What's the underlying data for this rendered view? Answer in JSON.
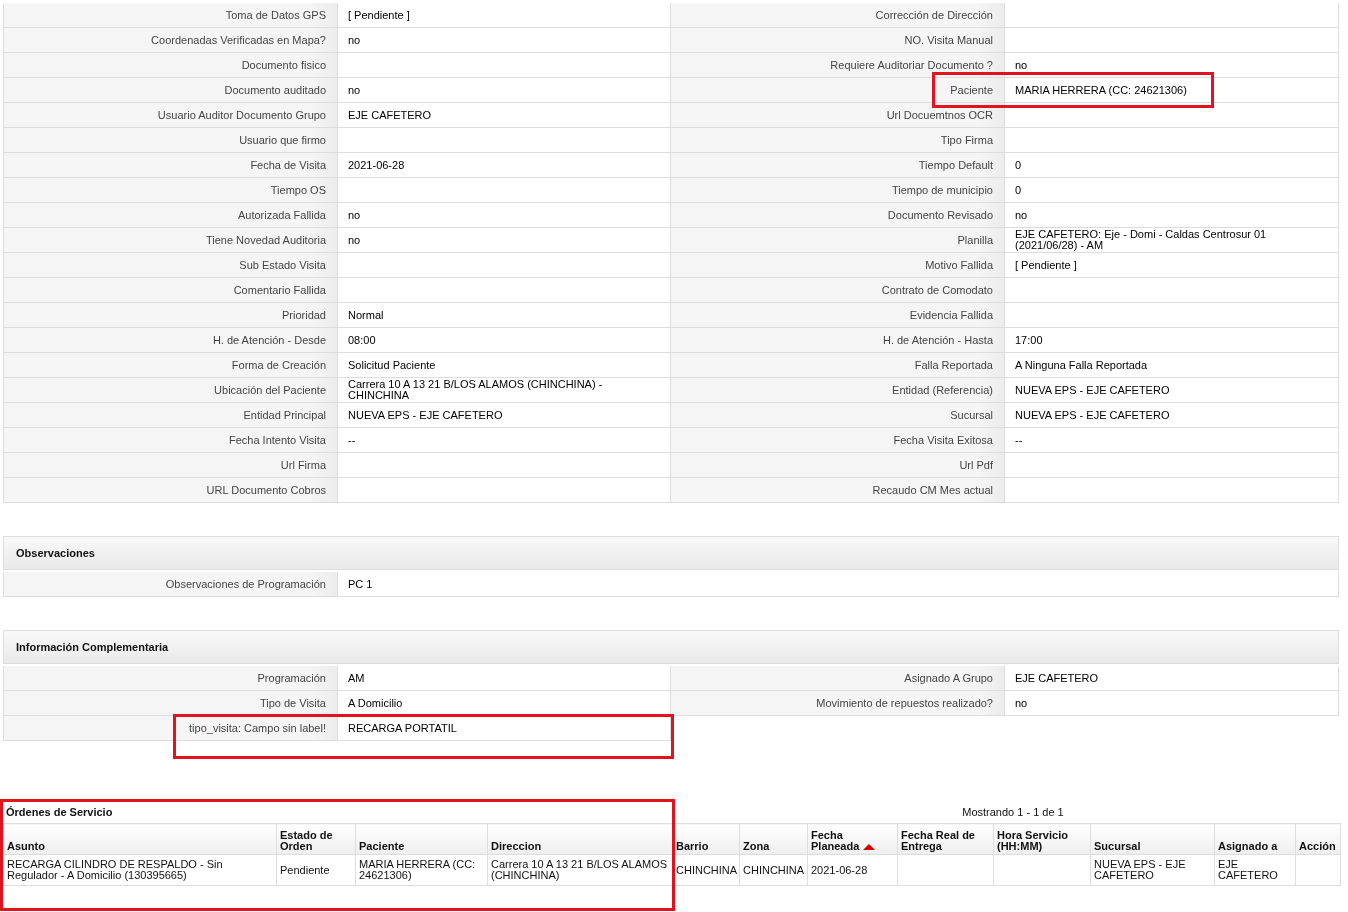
{
  "detail_rows": [
    [
      {
        "label": "Toma de Datos GPS",
        "value": "[ Pendiente ]"
      },
      {
        "label": "Corrección de Dirección"
      }
    ],
    [
      {
        "label": "Coordenadas Verificadas en Mapa?",
        "value": "no"
      },
      {
        "label": "NO. Visita Manual"
      }
    ],
    [
      {
        "label": "Documento fisico"
      },
      {
        "label": "Requiere Auditoriar Documento ?",
        "value": "no"
      }
    ],
    [
      {
        "label": "Documento auditado",
        "value": "no"
      },
      {
        "label": "Paciente",
        "value": "MARIA HERRERA (CC: 24621306)"
      }
    ],
    [
      {
        "label": "Usuario Auditor Documento Grupo",
        "value": "EJE CAFETERO"
      },
      {
        "label": "Url Docuemtnos OCR"
      }
    ],
    [
      {
        "label": "Usuario que firmo"
      },
      {
        "label": "Tipo Firma"
      }
    ],
    [
      {
        "label": "Fecha de Visita",
        "value": "2021-06-28"
      },
      {
        "label": "Tiempo Default",
        "value": "0"
      }
    ],
    [
      {
        "label": "Tiempo OS"
      },
      {
        "label": "Tiempo de municipio",
        "value": "0"
      }
    ],
    [
      {
        "label": "Autorizada Fallida",
        "value": "no"
      },
      {
        "label": "Documento Revisado",
        "value": "no"
      }
    ],
    [
      {
        "label": "Tiene Novedad Auditoria",
        "value": "no"
      },
      {
        "label": "Planilla",
        "value": "EJE CAFETERO: Eje - Domi - Caldas Centrosur 01 (2021/06/28) - AM"
      }
    ],
    [
      {
        "label": "Sub Estado Visita"
      },
      {
        "label": "Motivo Fallida",
        "value": "[ Pendiente ]"
      }
    ],
    [
      {
        "label": "Comentario Fallida"
      },
      {
        "label": "Contrato de Comodato"
      }
    ],
    [
      {
        "label": "Prioridad",
        "value": "Normal"
      },
      {
        "label": "Evidencia Fallida"
      }
    ],
    [
      {
        "label": "H. de Atención - Desde",
        "value": "08:00"
      },
      {
        "label": "H. de Atención - Hasta",
        "value": "17:00"
      }
    ],
    [
      {
        "label": "Forma de Creación",
        "value": "Solicitud Paciente"
      },
      {
        "label": "Falla Reportada",
        "value": "A Ninguna Falla Reportada"
      }
    ],
    [
      {
        "label": "Ubicación del Paciente",
        "value": "Carrera 10 A 13 21 B/LOS ALAMOS (CHINCHINA) - CHINCHINA"
      },
      {
        "label": "Entidad (Referencia)",
        "value": "NUEVA EPS - EJE CAFETERO"
      }
    ],
    [
      {
        "label": "Entidad Principal",
        "value": "NUEVA EPS - EJE CAFETERO"
      },
      {
        "label": "Sucursal",
        "value": "NUEVA EPS - EJE CAFETERO"
      }
    ],
    [
      {
        "label": "Fecha Intento Visita",
        "value": "--"
      },
      {
        "label": "Fecha Visita Exitosa",
        "value": "--"
      }
    ],
    [
      {
        "label": "Url Firma"
      },
      {
        "label": "Url Pdf"
      }
    ],
    [
      {
        "label": "URL Documento Cobros"
      },
      {
        "label": "Recaudo CM Mes actual"
      }
    ]
  ],
  "observaciones": {
    "title": "Observaciones",
    "rows": [
      [
        {
          "label": "Observaciones de Programación",
          "value": "PC 1"
        }
      ]
    ]
  },
  "informacion_complementaria": {
    "title": "Información Complementaria",
    "rows": [
      [
        {
          "label": "Programación",
          "value": "AM"
        },
        {
          "label": "Asignado A Grupo",
          "value": "EJE CAFETERO"
        }
      ],
      [
        {
          "label": "Tipo de Visita",
          "value": "A Domicilio"
        },
        {
          "label": "Movimiento de repuestos realizado?",
          "value": "no"
        }
      ],
      [
        {
          "label": "tipo_visita: Campo sin label!",
          "value": "RECARGA PORTATIL"
        }
      ]
    ]
  },
  "ordenes": {
    "title": "Órdenes de Servicio",
    "paging": "Mostrando 1 - 1 de 1",
    "columns": [
      {
        "label": "Asunto",
        "sorted": false
      },
      {
        "label": "Estado de Orden",
        "sorted": false
      },
      {
        "label": "Paciente",
        "sorted": false
      },
      {
        "label": "Direccion",
        "sorted": false
      },
      {
        "label": "Barrio",
        "sorted": false
      },
      {
        "label": "Zona",
        "sorted": false
      },
      {
        "label": "Fecha Planeada",
        "sorted": true
      },
      {
        "label": "Fecha Real de Entrega",
        "sorted": false
      },
      {
        "label": "Hora Servicio (HH:MM)",
        "sorted": false
      },
      {
        "label": "Sucursal",
        "sorted": false
      },
      {
        "label": "Asignado a",
        "sorted": false
      },
      {
        "label": "Acción",
        "sorted": false
      }
    ],
    "rows": [
      [
        "RECARGA CILINDRO DE RESPALDO - Sin Regulador - A Domicilio (130395665)",
        "Pendiente",
        "MARIA HERRERA (CC: 24621306)",
        "Carrera 10 A 13 21 B/LOS ALAMOS (CHINCHINA)",
        "CHINCHINA",
        "CHINCHINA",
        "2021-06-28",
        null,
        null,
        "NUEVA EPS - EJE CAFETERO",
        "EJE CAFETERO",
        null
      ]
    ]
  }
}
